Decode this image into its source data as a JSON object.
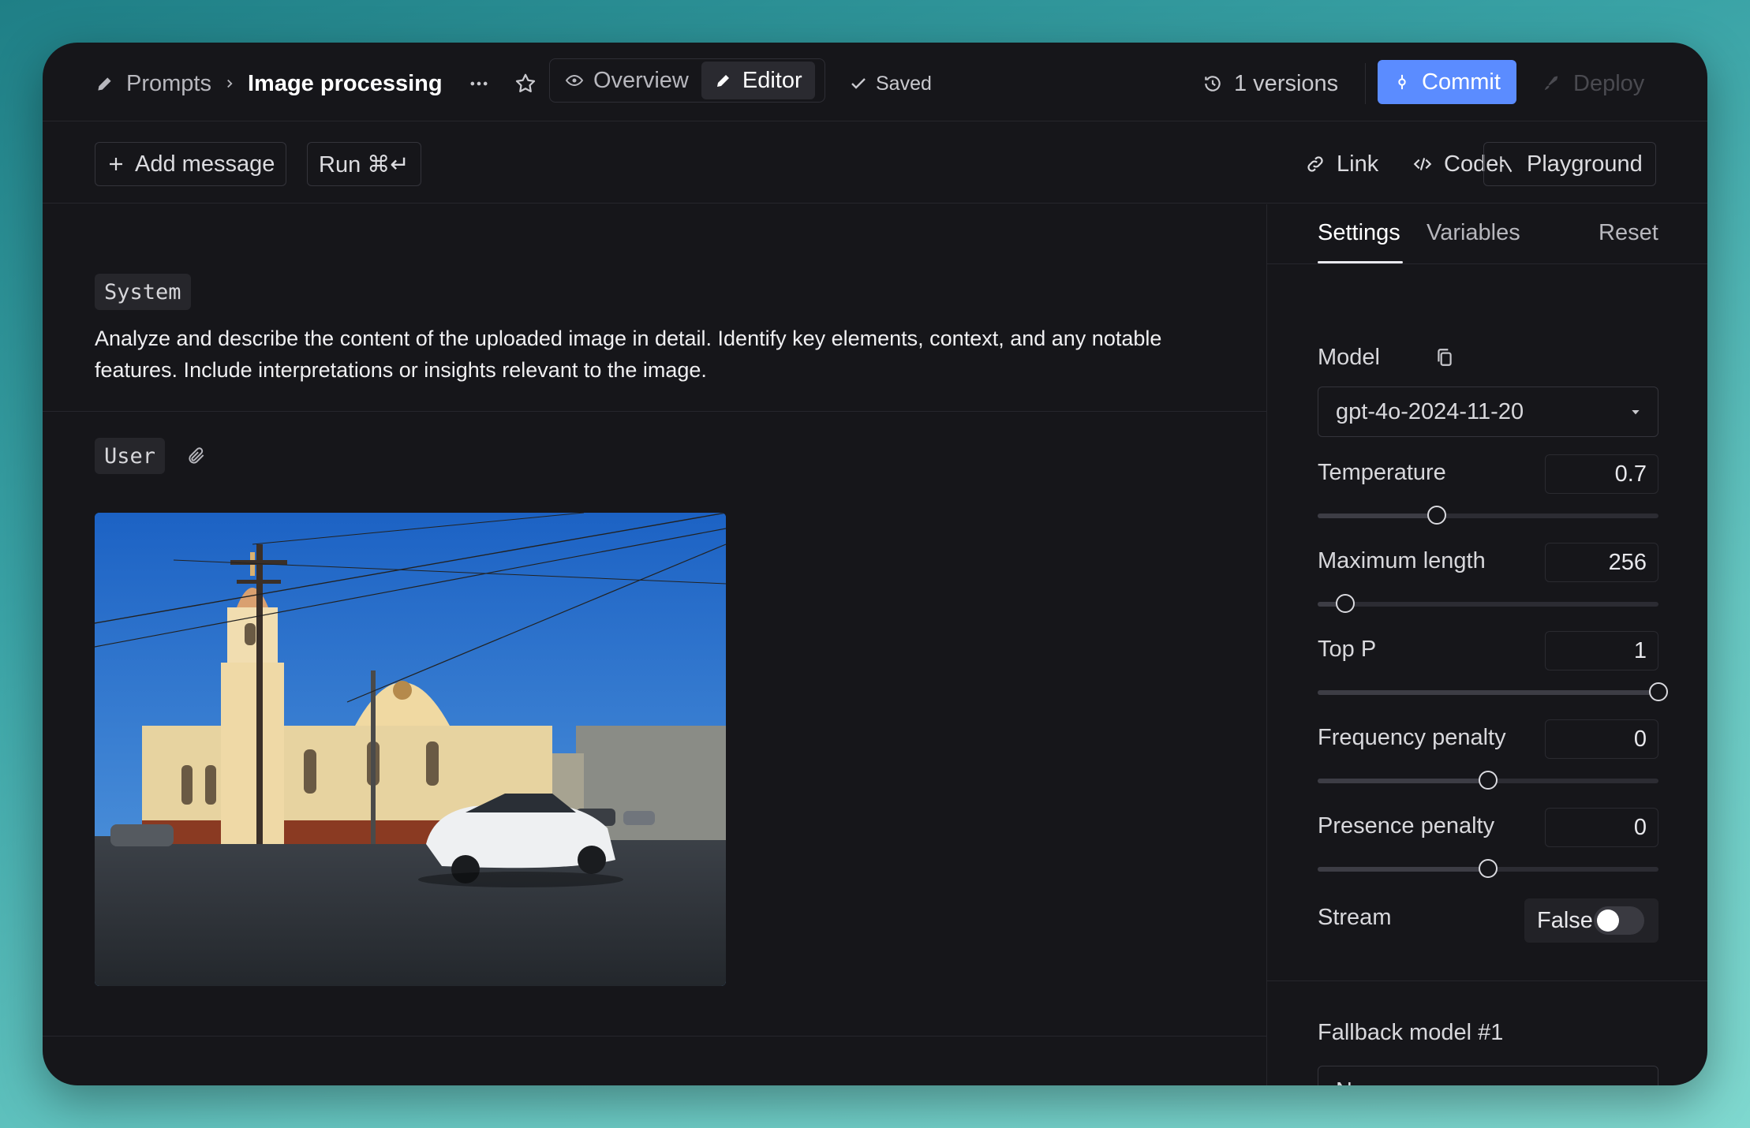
{
  "breadcrumb": {
    "root": "Prompts",
    "current": "Image processing"
  },
  "view_tabs": [
    {
      "label": "Overview"
    },
    {
      "label": "Editor"
    }
  ],
  "status": {
    "saved": "Saved"
  },
  "versions": {
    "label": "1 versions"
  },
  "actions": {
    "commit": "Commit",
    "deploy": "Deploy"
  },
  "toolbar": {
    "add_message": "Add message",
    "run": "Run ⌘↵",
    "link": "Link",
    "code": "Code",
    "playground": "Playground"
  },
  "messages": {
    "system": {
      "role": "System",
      "text": "Analyze and describe the content of the uploaded image in detail. Identify key elements, context, and any notable features. Include interpretations or insights relevant to the image."
    },
    "user": {
      "role": "User"
    }
  },
  "settings": {
    "tabs": {
      "settings": "Settings",
      "variables": "Variables",
      "reset": "Reset"
    },
    "model": {
      "label": "Model",
      "value": "gpt-4o-2024-11-20"
    },
    "temperature": {
      "label": "Temperature",
      "value": "0.7",
      "fraction": 0.35
    },
    "max_length": {
      "label": "Maximum length",
      "value": "256",
      "fraction": 0.08
    },
    "top_p": {
      "label": "Top P",
      "value": "1",
      "fraction": 1.0
    },
    "frequency_penalty": {
      "label": "Frequency penalty",
      "value": "0",
      "fraction": 0.5
    },
    "presence_penalty": {
      "label": "Presence penalty",
      "value": "0",
      "fraction": 0.5
    },
    "stream": {
      "label": "Stream",
      "value": "False"
    },
    "fallback": {
      "label": "Fallback model #1",
      "value": "None"
    }
  },
  "colors": {
    "accent": "#5b8cff",
    "background": "#16161a"
  }
}
